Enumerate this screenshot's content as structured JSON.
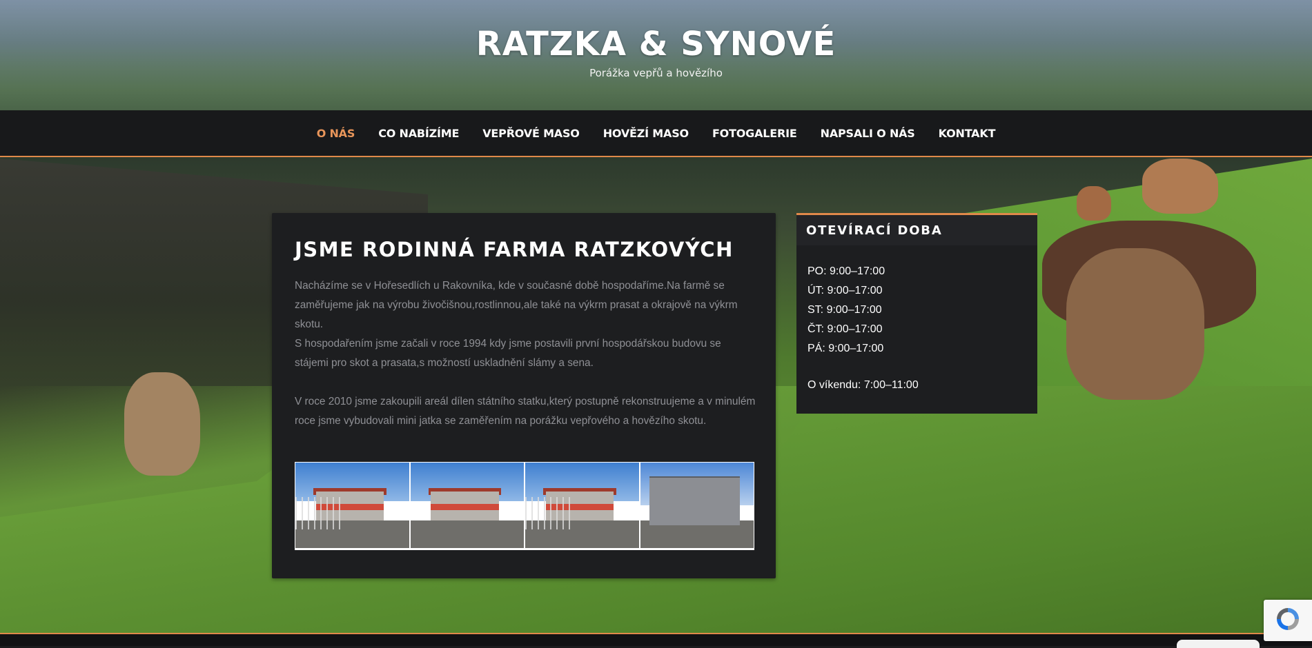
{
  "site": {
    "title": "RATZKA & SYNOVÉ",
    "tagline": "Porážka vepřů a hovězího"
  },
  "nav": {
    "items": [
      {
        "label": "O NÁS",
        "active": true
      },
      {
        "label": "CO NABÍZÍME",
        "active": false
      },
      {
        "label": "VEPŘOVÉ MASO",
        "active": false
      },
      {
        "label": "HOVĚZÍ MASO",
        "active": false
      },
      {
        "label": "FOTOGALERIE",
        "active": false
      },
      {
        "label": "NAPSALI O NÁS",
        "active": false
      },
      {
        "label": "KONTAKT",
        "active": false
      }
    ]
  },
  "main": {
    "heading": "JSME RODINNÁ FARMA RATZKOVÝCH",
    "paragraphs": [
      "Nacházíme se v Hořesedlích u Rakovníka, kde v současné době hospodaříme.Na farmě se zaměřujeme jak na výrobu živočišnou,rostlinnou,ale také na výkrm prasat a okrajově na výkrm skotu.",
      "S hospodařením jsme začali v roce 1994 kdy jsme postavili první hospodářskou budovu se stájemi pro skot a prasata,s možností uskladnění slámy a sena.",
      "V roce 2010 jsme zakoupili areál dílen státního statku,který postupně rekonstruujeme a v minulém roce jsme vybudovali mini jatka se zaměřením na porážku vepřového a hovězího skotu."
    ]
  },
  "sidebar": {
    "widget_title": "OTEVÍRACÍ DOBA",
    "hours": [
      "PO: 9:00–17:00",
      "ÚT: 9:00–17:00",
      "ST: 9:00–17:00",
      "ČT: 9:00–17:00",
      "PÁ: 9:00–17:00"
    ],
    "weekend": "O víkendu: 7:00–11:00"
  },
  "colors": {
    "accent": "#e0894a",
    "panel": "#1d1e20",
    "nav_bg": "#18191b"
  }
}
